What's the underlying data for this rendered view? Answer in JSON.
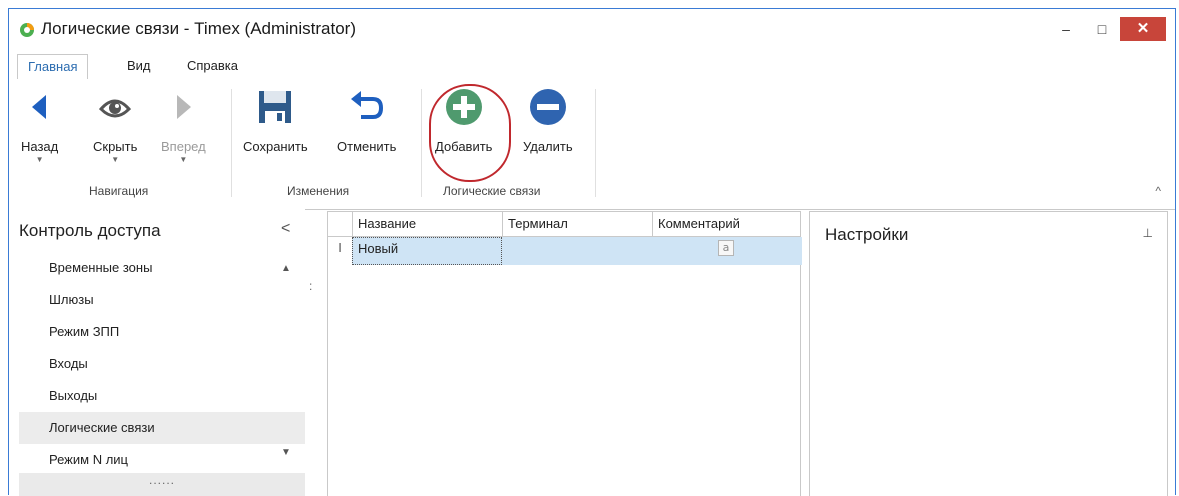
{
  "window": {
    "title": "Логические связи - Timex (Administrator)",
    "controls": {
      "minimize": "–",
      "maximize": "□",
      "close": "✕"
    },
    "accent_color": "#3a7bd5",
    "close_color": "#c8453a"
  },
  "ribbon_tabs": [
    {
      "label": "Главная",
      "active": true
    },
    {
      "label": "Вид",
      "active": false
    },
    {
      "label": "Справка",
      "active": false
    }
  ],
  "ribbon": {
    "buttons": {
      "back": {
        "label": "Назад",
        "icon": "arrow-left-icon",
        "enabled": true
      },
      "hide": {
        "label": "Скрыть",
        "icon": "eye-icon",
        "enabled": true
      },
      "forward": {
        "label": "Вперед",
        "icon": "arrow-right-icon",
        "enabled": false
      },
      "save": {
        "label": "Сохранить",
        "icon": "floppy-disk-icon",
        "enabled": true
      },
      "cancel": {
        "label": "Отменить",
        "icon": "undo-icon",
        "enabled": true
      },
      "add": {
        "label": "Добавить",
        "icon": "plus-circle-icon",
        "enabled": true,
        "highlighted": true
      },
      "delete": {
        "label": "Удалить",
        "icon": "minus-circle-icon",
        "enabled": true
      }
    },
    "groups": {
      "navigation": "Навигация",
      "changes": "Изменения",
      "logical_links": "Логические связи"
    },
    "collapse_glyph": "^"
  },
  "nav": {
    "title": "Контроль доступа",
    "collapse_glyph": "<",
    "items": [
      {
        "label": "Временные зоны",
        "selected": false
      },
      {
        "label": "Шлюзы",
        "selected": false
      },
      {
        "label": "Режим ЗПП",
        "selected": false
      },
      {
        "label": "Входы",
        "selected": false
      },
      {
        "label": "Выходы",
        "selected": false
      },
      {
        "label": "Логические связи",
        "selected": true
      },
      {
        "label": "Режим N лиц",
        "selected": false
      }
    ],
    "scroll_up_glyph": "▲",
    "scroll_down_glyph": "▼",
    "grip": "......",
    "splitter": ":"
  },
  "grid": {
    "columns": [
      "Название",
      "Терминал",
      "Комментарий"
    ],
    "rows": [
      {
        "indicator": "I",
        "name": "Новый",
        "terminal": "",
        "comment_icon": "a"
      }
    ],
    "selected_row_color": "#cfe4f5"
  },
  "settings_panel": {
    "title": "Настройки",
    "pin_glyph": "⊥"
  }
}
